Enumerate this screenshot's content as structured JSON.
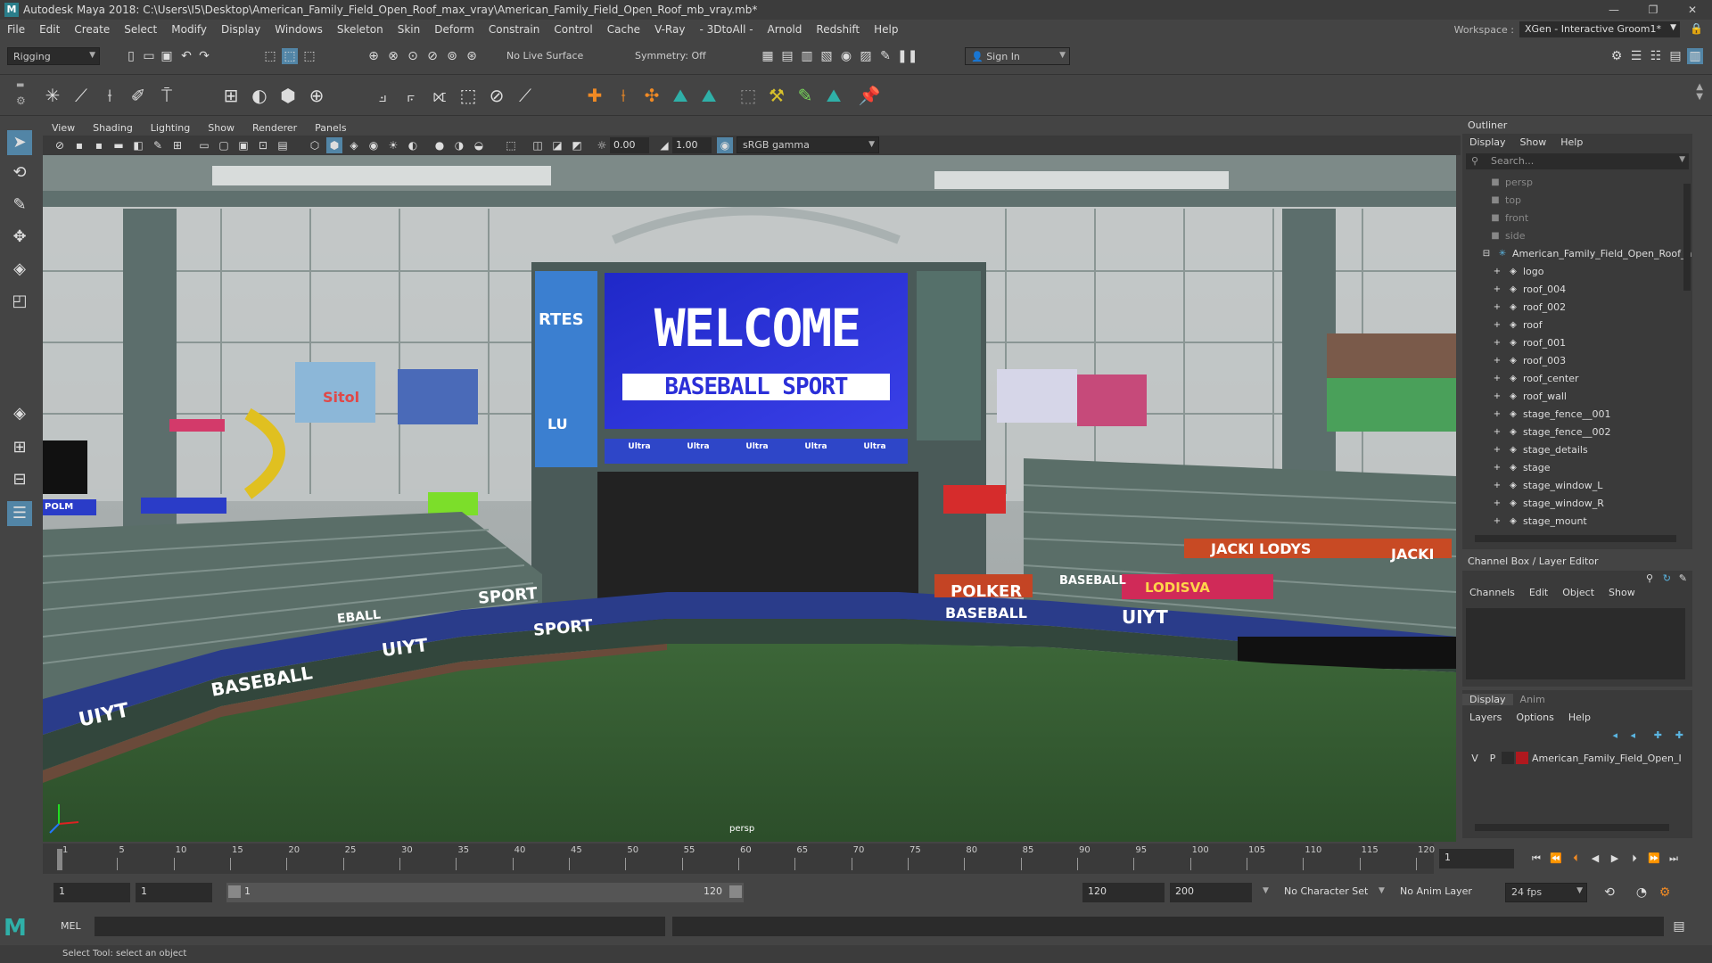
{
  "window": {
    "title": "Autodesk Maya 2018: C:\\Users\\I5\\Desktop\\American_Family_Field_Open_Roof_max_vray\\American_Family_Field_Open_Roof_mb_vray.mb*",
    "controls": [
      "—",
      "❐",
      "✕"
    ]
  },
  "menubar": {
    "items": [
      "File",
      "Edit",
      "Create",
      "Select",
      "Modify",
      "Display",
      "Windows",
      "Skeleton",
      "Skin",
      "Deform",
      "Constrain",
      "Control",
      "Cache",
      "V-Ray",
      "- 3DtoAll -",
      "Arnold",
      "Redshift",
      "Help"
    ],
    "workspace_label": "Workspace :",
    "workspace_value": "XGen - Interactive Groom1*"
  },
  "statusline": {
    "menuset": "Rigging",
    "live_surface": "No Live Surface",
    "symmetry": "Symmetry: Off",
    "sign_in": "Sign In"
  },
  "viewport_menu": {
    "items": [
      "View",
      "Shading",
      "Lighting",
      "Show",
      "Renderer",
      "Panels"
    ],
    "exposure": "0.00",
    "gamma": "1.00",
    "colorspace": "sRGB gamma",
    "camera_label": "persp"
  },
  "scene": {
    "scoreboard_main": "WELCOME",
    "scoreboard_sub": "BASEBALL SPORT",
    "scoreboard_ribbon": [
      "Ultra",
      "Ultra",
      "Ultra",
      "Ultra",
      "Ultra"
    ],
    "left_panel_top": "RTES",
    "left_panel_mid": "LU",
    "banner_sitol": "Sitol",
    "banner_polker": "POLKER",
    "banner_lodisva": "LODISVA",
    "banner_jacki_lodys": "JACKI LODYS",
    "banner_jacki": "JACKI",
    "wall_sport_1": "SPORT",
    "wall_sport_2": "SPORT",
    "wall_baseball_1": "BASEBALL",
    "wall_baseball_2": "BASEBALL",
    "wall_baseball_3": "BASEBALL",
    "wall_uiyt_1": "UIYT",
    "wall_uiyt_2": "UIYT",
    "wall_uiyt_3": "UIYT",
    "wall_ebal": "EBALL",
    "wall_polm": "POLM"
  },
  "outliner": {
    "title": "Outliner",
    "menu": [
      "Display",
      "Show",
      "Help"
    ],
    "search_placeholder": "Search...",
    "cameras": [
      "persp",
      "top",
      "front",
      "side"
    ],
    "group": "American_Family_Field_Open_Roof_n",
    "children": [
      "logo",
      "roof_004",
      "roof_002",
      "roof",
      "roof_001",
      "roof_003",
      "roof_center",
      "roof_wall",
      "stage_fence__001",
      "stage_fence__002",
      "stage_details",
      "stage",
      "stage_window_L",
      "stage_window_R",
      "stage_mount"
    ]
  },
  "channelbox": {
    "title": "Channel Box / Layer Editor",
    "menu": [
      "Channels",
      "Edit",
      "Object",
      "Show"
    ]
  },
  "layereditor": {
    "tabs": [
      "Display",
      "Anim"
    ],
    "menu": [
      "Layers",
      "Options",
      "Help"
    ],
    "layer_v": "V",
    "layer_p": "P",
    "layer_name": "American_Family_Field_Open_I",
    "layer_color": "#b0181e"
  },
  "timeline": {
    "ticks": [
      "1",
      "5",
      "10",
      "15",
      "20",
      "25",
      "30",
      "35",
      "40",
      "45",
      "50",
      "55",
      "60",
      "65",
      "70",
      "75",
      "80",
      "85",
      "90",
      "95",
      "100",
      "105",
      "110",
      "115",
      "120"
    ],
    "current_frame": "1",
    "range_start": "1",
    "range_inner_start": "1",
    "slider_start": "1",
    "slider_end": "120",
    "range_end": "120",
    "anim_end": "200",
    "character_set": "No Character Set",
    "anim_layer": "No Anim Layer",
    "fps": "24 fps"
  },
  "command": {
    "mel_label": "MEL",
    "help_text": "Select Tool: select an object"
  },
  "colors": {
    "ui_bg": "#444444",
    "panel_bg": "#3a3a3a",
    "field_bg": "#2b2b2b",
    "accent": "#5285a6",
    "maya_teal": "#2b7e8a",
    "scoreboard_blue": "#2b2fd8",
    "grass": "#3f6a3c"
  }
}
